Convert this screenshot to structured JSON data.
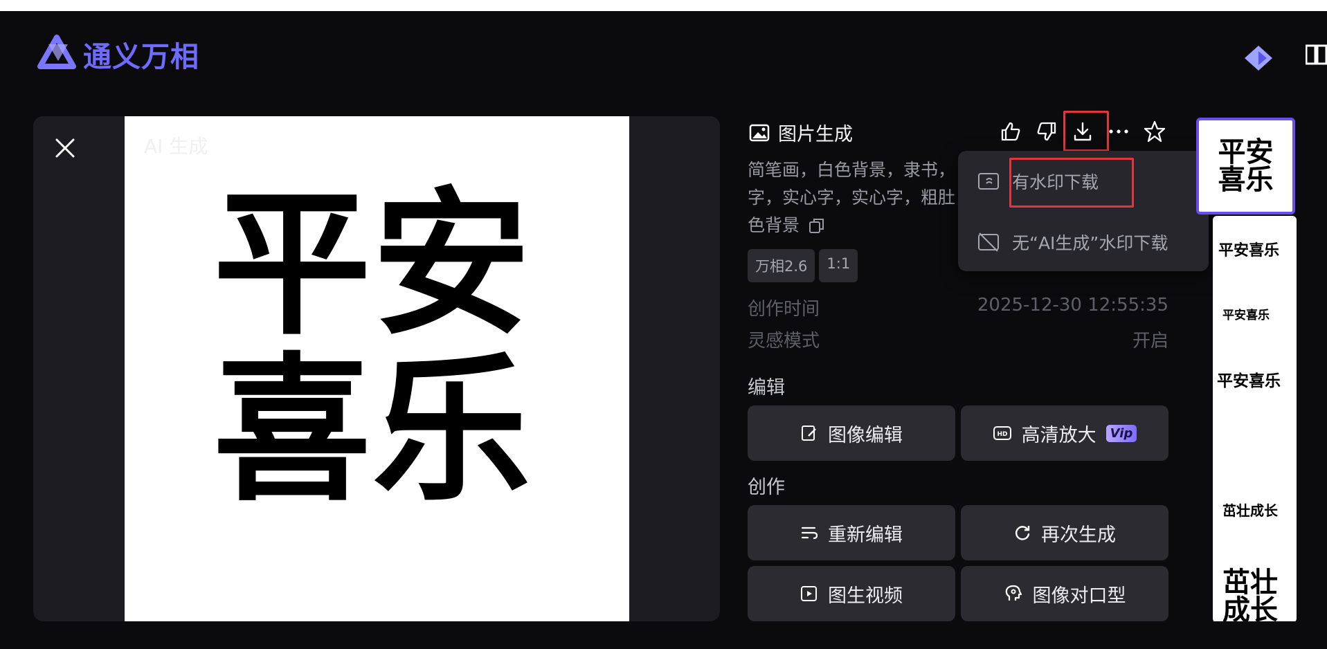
{
  "app": {
    "name": "通义万相"
  },
  "viewer": {
    "watermark": "AI 生成",
    "image_chars": [
      "平",
      "安",
      "喜",
      "乐"
    ]
  },
  "detail": {
    "title": "图片生成",
    "prompt_lines": [
      "简笔画，白色背景，隶书，",
      "字，实心字，实心字，粗肚",
      "色背景"
    ],
    "tags": [
      "万相2.6",
      "1:1"
    ],
    "created_label": "创作时间",
    "created_value": "2025-12-30 12:55:35",
    "inspiration_label": "灵感模式",
    "inspiration_value": "开启",
    "edit_section": "编辑",
    "create_section": "创作",
    "buttons": {
      "image_edit": "图像编辑",
      "upscale": "高清放大",
      "vip": "Vip",
      "re_edit": "重新编辑",
      "regenerate": "再次生成",
      "img_to_video": "图生视频",
      "lip_sync": "图像对口型"
    }
  },
  "download_menu": {
    "with_watermark": "有水印下载",
    "without_watermark": "无“AI生成”水印下载"
  },
  "thumbnails": [
    {
      "text": "平安\n喜乐"
    },
    {
      "text": "平安喜乐"
    },
    {
      "text": "平安喜乐"
    },
    {
      "text": "平安喜乐"
    },
    {
      "text": "茁壮成长"
    },
    {
      "text": "茁壮\n成长"
    }
  ],
  "colors": {
    "accent": "#6f6bff",
    "highlight": "#e2363f",
    "panel": "#2b2b31"
  }
}
